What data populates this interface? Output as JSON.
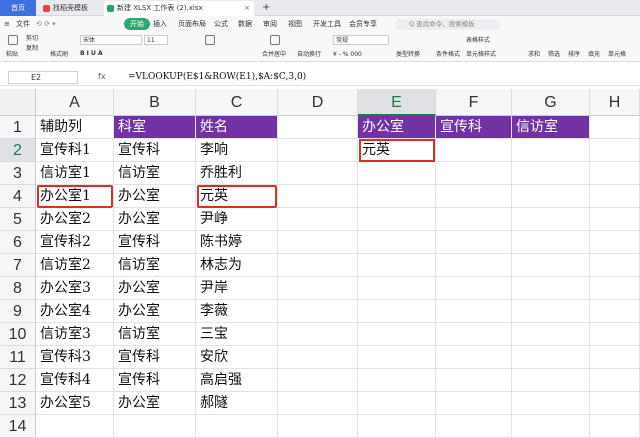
{
  "tabs": {
    "home": "首页",
    "template": "找稻壳模板",
    "file": "新建 XLSX 工作表 (2).xlsx",
    "new_tab": "+"
  },
  "menu": {
    "file": "文件",
    "items": [
      "开始",
      "插入",
      "页面布局",
      "公式",
      "数据",
      "审阅",
      "视图",
      "开发工具",
      "会员专享",
      "智能工具箱"
    ],
    "search_placeholder": "Q 查找命令、搜索模板"
  },
  "ribbon": {
    "paste": "粘贴",
    "cut": "剪切",
    "copy": "复制",
    "format_painter": "格式刷",
    "font_name": "宋体",
    "font_size": "11",
    "font_buttons": "B I U A",
    "merge_center": "合并居中",
    "wrap": "自动换行",
    "number_format": "常规",
    "type_convert": "类型转换",
    "cond_format": "条件格式",
    "table_style": "表格样式",
    "cell_style": "单元格样式",
    "sum": "求和",
    "filter": "筛选",
    "sort": "排序",
    "fill": "填充",
    "cell": "单元格",
    "percent": "¥ - % 000"
  },
  "formula_bar": {
    "name_box": "E2",
    "fx": "fx",
    "formula": "=VLOOKUP(E$1&ROW(E1),$A:$C,3,0)"
  },
  "columns": [
    "A",
    "B",
    "C",
    "D",
    "E",
    "F",
    "G",
    "H"
  ],
  "rows": [
    "1",
    "2",
    "3",
    "4",
    "5",
    "6",
    "7",
    "8",
    "9",
    "10",
    "11",
    "12",
    "13",
    "14"
  ],
  "sheet": {
    "A": [
      "辅助列",
      "宣传科1",
      "信访室1",
      "办公室1",
      "办公室2",
      "宣传科2",
      "信访室2",
      "办公室3",
      "办公室4",
      "信访室3",
      "宣传科3",
      "宣传科4",
      "办公室5",
      ""
    ],
    "B": [
      "科室",
      "宣传科",
      "信访室",
      "办公室",
      "办公室",
      "宣传科",
      "信访室",
      "办公室",
      "办公室",
      "信访室",
      "宣传科",
      "宣传科",
      "办公室",
      ""
    ],
    "C": [
      "姓名",
      "李响",
      "乔胜利",
      "元英",
      "尹峥",
      "陈书婷",
      "林志为",
      "尹岸",
      "李薇",
      "三宝",
      "安欣",
      "高启强",
      "郝隧",
      ""
    ],
    "E": [
      "办公室",
      "元英"
    ],
    "F": [
      "宣传科"
    ],
    "G": [
      "信访室"
    ]
  },
  "colors": {
    "header_fill": "#7232a4",
    "header_text": "#ffffff",
    "highlight_border": "#d93025",
    "active_accent": "#1f7a4a"
  }
}
